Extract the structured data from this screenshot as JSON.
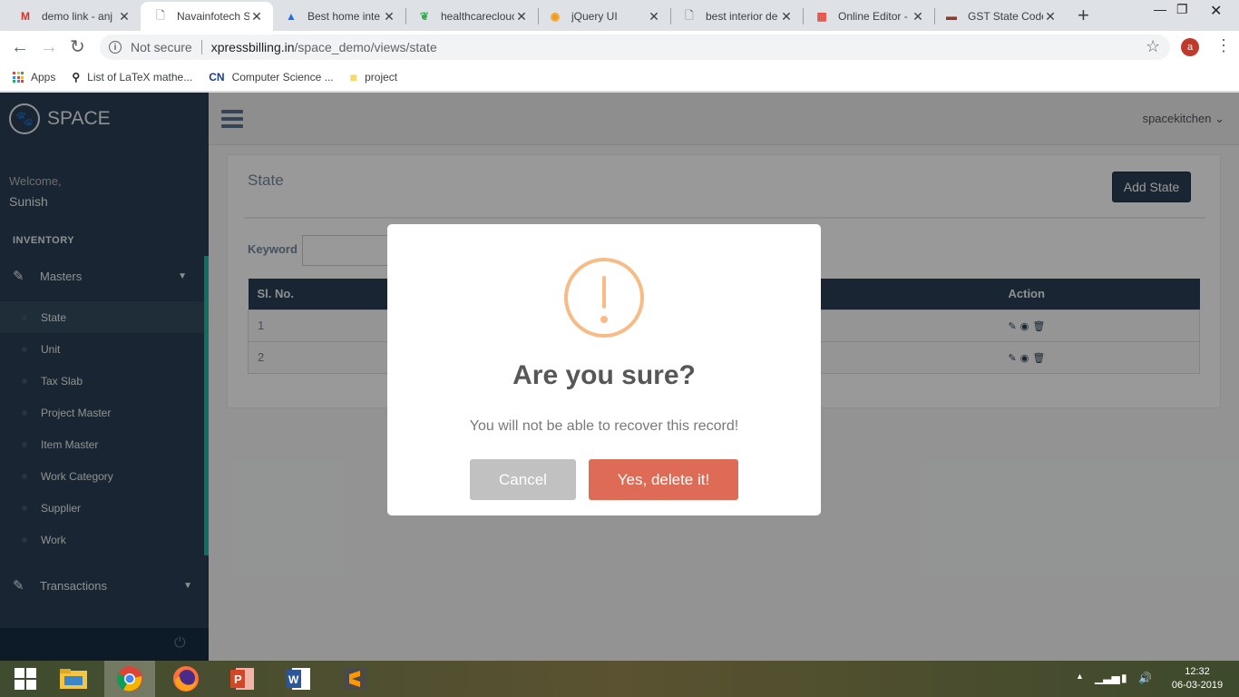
{
  "browser": {
    "tabs": [
      {
        "title": "demo link - anj",
        "icon": "gmail-icon",
        "active": false
      },
      {
        "title": "Navainfotech S",
        "icon": "page-icon",
        "active": true
      },
      {
        "title": "Best home inte",
        "icon": "photo-icon",
        "active": false
      },
      {
        "title": "healthcareclouc",
        "icon": "leaf-icon",
        "active": false
      },
      {
        "title": "jQuery UI",
        "icon": "jquery-icon",
        "active": false
      },
      {
        "title": "best interior de",
        "icon": "page-icon",
        "active": false
      },
      {
        "title": "Online Editor -",
        "icon": "editor-icon",
        "active": false
      },
      {
        "title": "GST State Code",
        "icon": "gst-icon",
        "active": false
      }
    ],
    "security_label": "Not secure",
    "url_host": "xpressbilling.in",
    "url_path": "/space_demo/views/state",
    "profile_initial": "a",
    "bookmarks": [
      "Apps",
      "List of LaTeX mathe...",
      "Computer Science ...",
      "project"
    ]
  },
  "app": {
    "brand": "SPACE",
    "welcome": "Welcome,",
    "user_name": "Sunish",
    "section": "INVENTORY",
    "masters_label": "Masters",
    "masters_items": [
      "State",
      "Unit",
      "Tax Slab",
      "Project Master",
      "Item Master",
      "Work Category",
      "Supplier",
      "Work"
    ],
    "transactions_label": "Transactions",
    "account": "spacekitchen"
  },
  "main": {
    "title": "State",
    "add_button": "Add State",
    "keyword_label": "Keyword",
    "columns": {
      "sl": "Sl. No.",
      "action": "Action"
    },
    "rows": [
      {
        "sl": "1"
      },
      {
        "sl": "2"
      }
    ]
  },
  "dialog": {
    "title": "Are you sure?",
    "text": "You will not be able to recover this record!",
    "cancel": "Cancel",
    "confirm": "Yes, delete it!",
    "confirm_color": "#dd6b55",
    "cancel_color": "#c1c1c1",
    "icon_color": "#f8bb86"
  },
  "taskbar": {
    "time": "12:32",
    "date": "06-03-2019",
    "apps": [
      "windows-start-icon",
      "file-explorer-icon",
      "chrome-icon",
      "firefox-icon",
      "powerpoint-icon",
      "word-icon",
      "sublime-icon"
    ]
  }
}
